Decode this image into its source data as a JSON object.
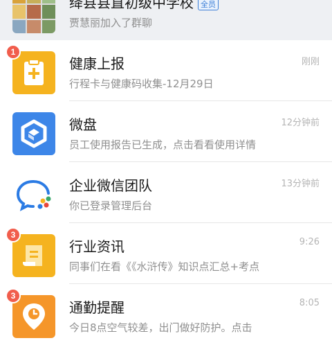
{
  "chats": [
    {
      "id": "group",
      "title": "绛县县直初级中学校",
      "tag": "全员",
      "preview": "贾慧丽加入了群聊",
      "time": "",
      "badge": ""
    },
    {
      "id": "health",
      "title": "健康上报",
      "preview": "行程卡与健康码收集-12月29日",
      "time": "刚刚",
      "badge": "1",
      "icon": "health-report-icon",
      "color": "#f5b31f"
    },
    {
      "id": "drive",
      "title": "微盘",
      "preview": "员工使用报告已生成，点击看看使用详情",
      "time": "12分钟前",
      "badge": "",
      "icon": "cloud-drive-icon",
      "color": "#3d86e8"
    },
    {
      "id": "team",
      "title": "企业微信团队",
      "preview": "你已登录管理后台",
      "time": "13分钟前",
      "badge": "",
      "icon": "wecom-logo-icon",
      "color": "#ffffff"
    },
    {
      "id": "news",
      "title": "行业资讯",
      "preview": "同事们在看《《水浒传》知识点汇总+考点",
      "time": "9:26",
      "badge": "3",
      "icon": "news-scroll-icon",
      "color": "#f5b31f"
    },
    {
      "id": "commute",
      "title": "通勤提醒",
      "preview": "今日8点空气较差，出门做好防护。点击",
      "time": "8:05",
      "badge": "3",
      "icon": "location-clock-icon",
      "color": "#f5962a"
    }
  ]
}
